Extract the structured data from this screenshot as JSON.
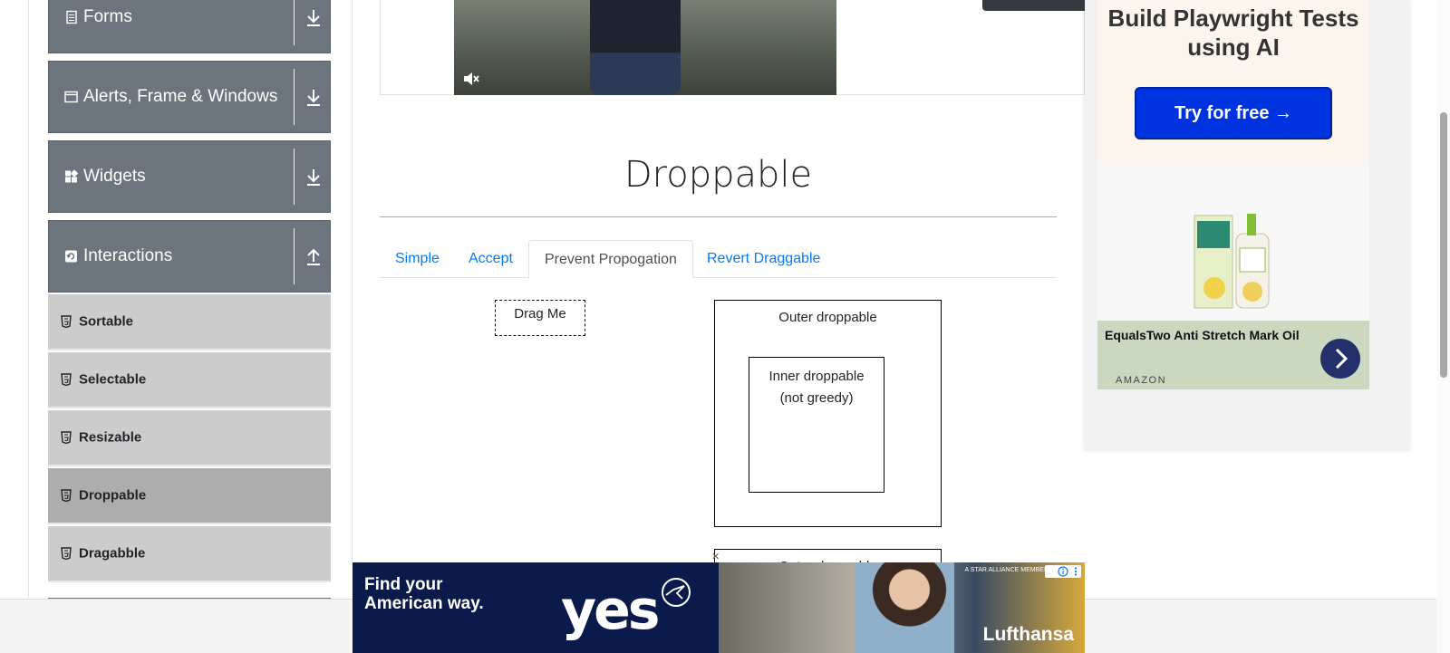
{
  "sidebar": {
    "groups": [
      {
        "label": "Forms",
        "icon": "document-icon",
        "arrow": "download-arrow-icon"
      },
      {
        "label": "Alerts, Frame & Windows",
        "icon": "window-icon",
        "arrow": "download-arrow-icon"
      },
      {
        "label": "Widgets",
        "icon": "widgets-icon",
        "arrow": "download-arrow-icon"
      },
      {
        "label": "Interactions",
        "icon": "refresh-icon",
        "arrow": "upload-arrow-icon"
      }
    ],
    "items": [
      {
        "label": "Sortable",
        "active": false
      },
      {
        "label": "Selectable",
        "active": false
      },
      {
        "label": "Resizable",
        "active": false
      },
      {
        "label": "Droppable",
        "active": true
      },
      {
        "label": "Dragabble",
        "active": false
      }
    ]
  },
  "main": {
    "title": "Droppable",
    "tabs": [
      {
        "label": "Simple",
        "active": false
      },
      {
        "label": "Accept",
        "active": false
      },
      {
        "label": "Prevent Propogation",
        "active": true
      },
      {
        "label": "Revert Draggable",
        "active": false
      }
    ],
    "drag_me": "Drag Me",
    "outer_droppable": "Outer droppable",
    "inner_droppable_line1": "Inner droppable",
    "inner_droppable_line2": "(not greedy)",
    "outer_droppable_2": "Outer droppable"
  },
  "right_ad": {
    "headline": "Build Playwright Tests using AI",
    "cta": "Try for free →",
    "product_name": "EqualsTwo Anti Stretch Mark Oil",
    "product_source": "AMAZON"
  },
  "bottom_ad": {
    "tagline": "Find your American way.",
    "slogan": "yes",
    "brand": "Lufthansa",
    "small_text": "A STAR ALLIANCE MEMBER"
  },
  "colors": {
    "group_header": "#6c757d",
    "menu_item": "#cccccc",
    "menu_item_active": "#adadad",
    "link": "#007bff",
    "ad_cta": "#0033e0"
  }
}
